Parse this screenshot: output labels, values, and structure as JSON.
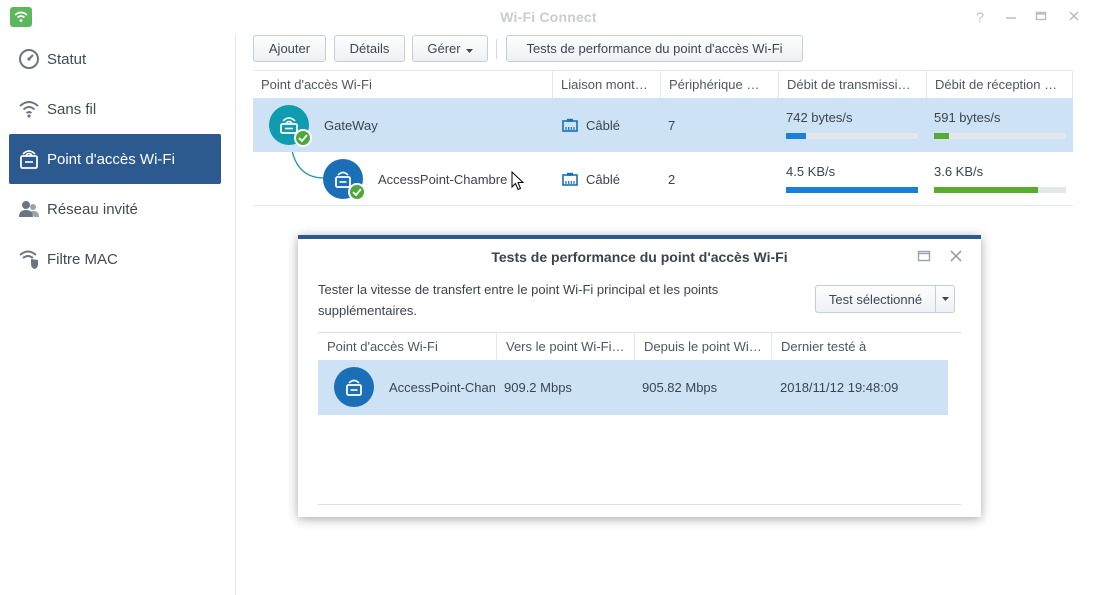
{
  "window": {
    "title": "Wi-Fi Connect"
  },
  "sidebar": {
    "items": [
      {
        "label": "Statut",
        "icon": "gauge-icon"
      },
      {
        "label": "Sans fil",
        "icon": "wifi-icon"
      },
      {
        "label": "Point d'accès Wi-Fi",
        "icon": "access-point-icon",
        "active": true
      },
      {
        "label": "Réseau invité",
        "icon": "guest-users-icon"
      },
      {
        "label": "Filtre MAC",
        "icon": "shield-wifi-icon"
      }
    ]
  },
  "toolbar": {
    "add_label": "Ajouter",
    "details_label": "Détails",
    "manage_label": "Gérer",
    "perf_test_label": "Tests de performance du point d'accès Wi-Fi"
  },
  "table": {
    "columns": [
      "Point d'accès Wi-Fi",
      "Liaison mont…",
      "Périphérique …",
      "Débit de transmissi…",
      "Débit de réception …"
    ],
    "rows": [
      {
        "name": "GateWay",
        "link": "Câblé",
        "devices": "7",
        "tx": "742 bytes/s",
        "tx_level": 0.15,
        "rx": "591 bytes/s",
        "rx_level": 0.11
      },
      {
        "name": "AccessPoint-Chambre",
        "link": "Câblé",
        "devices": "2",
        "tx": "4.5 KB/s",
        "tx_level": 1.0,
        "rx": "3.6 KB/s",
        "rx_level": 0.79
      }
    ]
  },
  "dialog": {
    "title": "Tests de performance du point d'accès Wi-Fi",
    "description": "Tester la vitesse de transfert entre le point Wi-Fi principal et les points supplémentaires.",
    "test_button": "Test sélectionné",
    "columns": [
      "Point d'accès Wi-Fi",
      "Vers le point Wi-Fi…",
      "Depuis le point Wi…",
      "Dernier testé à"
    ],
    "rows": [
      {
        "name": "AccessPoint-Chan",
        "to_speed": "909.2 Mbps",
        "from_speed": "905.82 Mbps",
        "last_tested": "2018/11/12 19:48:09"
      }
    ]
  },
  "colors": {
    "accent": "#2c5a8e",
    "tx_bar": "#1a7fd6",
    "rx_bar": "#5aac2e",
    "row_selected": "#cde3f5",
    "gateway_icon": "#0f9cae",
    "ap_icon": "#1a6fb6"
  }
}
